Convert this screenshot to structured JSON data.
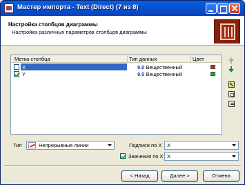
{
  "window": {
    "title": "Мастер импорта - Text (Direct) (7 из 8)"
  },
  "header": {
    "title": "Настройка столбцов диаграммы",
    "subtitle": "Настройка различных параметров столбцов диаграммы",
    "icon": "chart-columns-icon"
  },
  "table": {
    "columns": [
      "Метка столбца",
      "Тип данных",
      "Цвет"
    ],
    "rows": [
      {
        "checked": false,
        "selected": true,
        "label": "X",
        "dtype_num": "9.0",
        "dtype": "Вещественный",
        "color": "#e02020"
      },
      {
        "checked": true,
        "selected": false,
        "label": "Y",
        "dtype_num": "9.0",
        "dtype": "Вещественный",
        "color": "#20b020"
      }
    ]
  },
  "side_tools": [
    "arrow-up-icon",
    "arrow-down-icon",
    "chart-settings-icon",
    "copy-icon",
    "edit-icon"
  ],
  "options": {
    "type_label": "Тип",
    "type_value": "Непрерывные линии",
    "labels_label": "Подписи по X",
    "labels_value": "X",
    "values_label": "Значения по X",
    "values_value": "X",
    "values_checked": true
  },
  "buttons": {
    "back": "< Назад",
    "next": "Далее >",
    "cancel": "Отмена"
  }
}
